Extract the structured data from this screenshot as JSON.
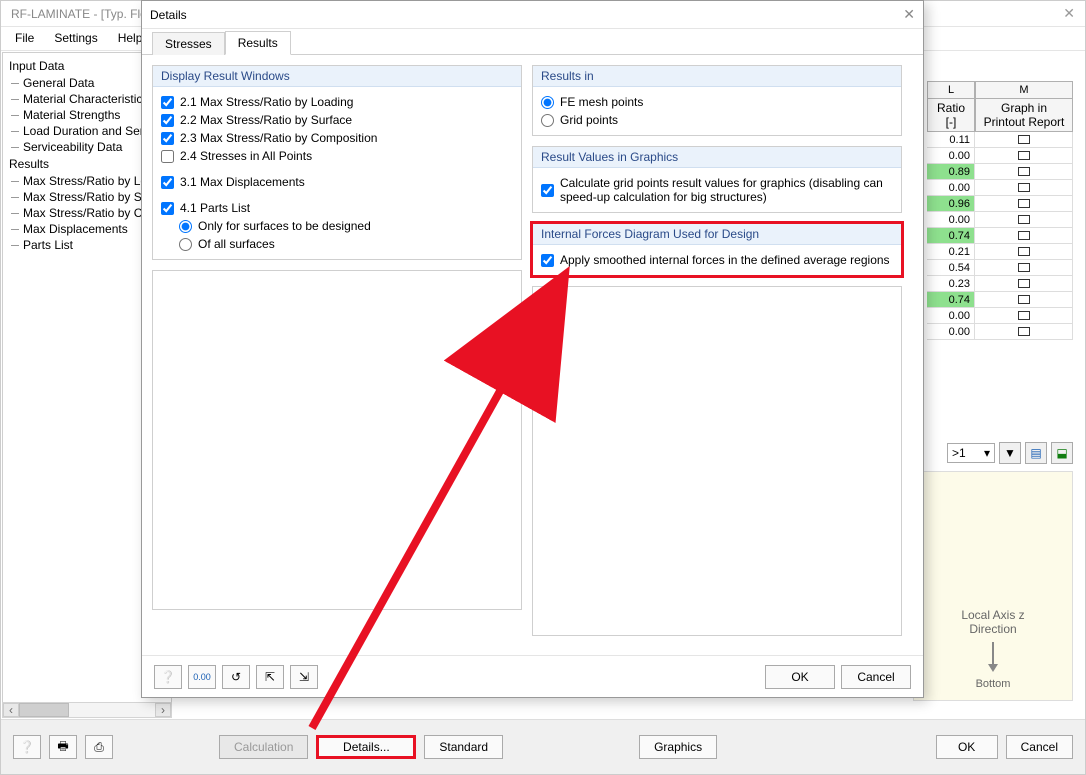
{
  "main": {
    "title": "RF-LAMINATE - [Typ. Floo",
    "menu": [
      "File",
      "Settings",
      "Help"
    ]
  },
  "tree": {
    "input_data": "Input Data",
    "input_items": [
      "General Data",
      "Material Characteristics",
      "Material Strengths",
      "Load Duration and Serv",
      "Serviceability Data"
    ],
    "results": "Results",
    "results_items": [
      "Max Stress/Ratio by Lo",
      "Max Stress/Ratio by Su",
      "Max Stress/Ratio by Co",
      "Max Displacements",
      "Parts List"
    ]
  },
  "table": {
    "col_l": "L",
    "col_m": "M",
    "h2_l": "Ratio",
    "h2_l2": "[-]",
    "h2_m": "Graph in",
    "h2_m2": "Printout Report",
    "rows": [
      {
        "l": "0.11",
        "g": false
      },
      {
        "l": "0.00",
        "g": false
      },
      {
        "l": "0.89",
        "g": true
      },
      {
        "l": "0.00",
        "g": false
      },
      {
        "l": "0.96",
        "g": true
      },
      {
        "l": "0.00",
        "g": false
      },
      {
        "l": "0.74",
        "g": true
      },
      {
        "l": "0.21",
        "g": false
      },
      {
        "l": "0.54",
        "g": false
      },
      {
        "l": "0.23",
        "g": false
      },
      {
        "l": "0.74",
        "g": true
      },
      {
        "l": "0.00",
        "g": false
      },
      {
        "l": "0.00",
        "g": false
      }
    ]
  },
  "filter": {
    "combo": ">1"
  },
  "preview": {
    "label1": "Local Axis z",
    "label2": "Direction",
    "bottom": "Bottom"
  },
  "bottom": {
    "calculation": "Calculation",
    "details": "Details...",
    "standard": "Standard",
    "graphics": "Graphics",
    "ok": "OK",
    "cancel": "Cancel"
  },
  "dialog": {
    "title": "Details",
    "tab_stresses": "Stresses",
    "tab_results": "Results",
    "group_display": "Display Result Windows",
    "c21": "2.1 Max Stress/Ratio by Loading",
    "c22": "2.2 Max Stress/Ratio by Surface",
    "c23": "2.3 Max Stress/Ratio by Composition",
    "c24": "2.4 Stresses in All Points",
    "c31": "3.1 Max Displacements",
    "c41": "4.1 Parts List",
    "r_only": "Only for surfaces to be designed",
    "r_all": "Of all surfaces",
    "group_resultsin": "Results in",
    "r_fe": "FE mesh points",
    "r_grid": "Grid points",
    "group_values": "Result Values in Graphics",
    "c_calc": "Calculate grid points result values for graphics (disabling can speed-up calculation for big structures)",
    "group_forces": "Internal Forces Diagram Used for Design",
    "c_smooth": "Apply smoothed internal forces in the defined average regions",
    "ok": "OK",
    "cancel": "Cancel"
  }
}
